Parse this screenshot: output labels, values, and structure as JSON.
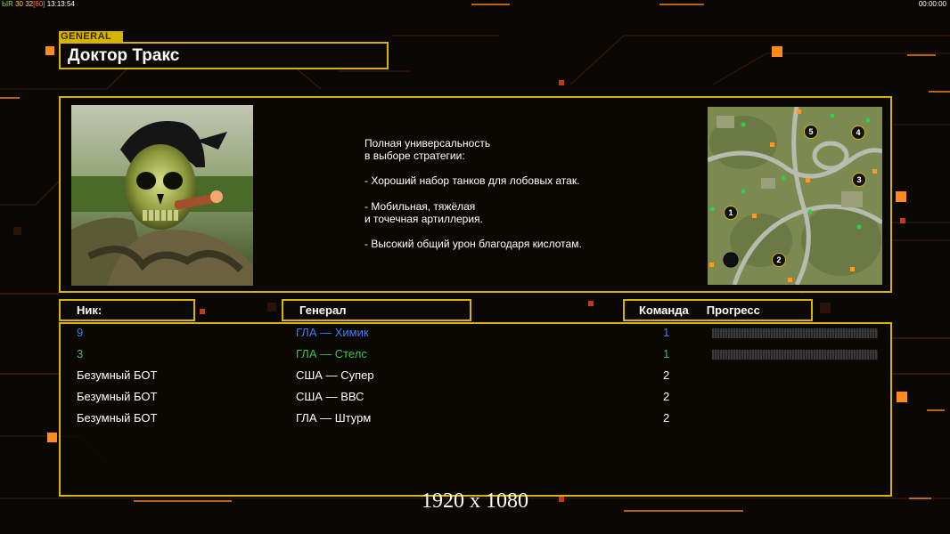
{
  "hud": {
    "left_prefix": "ЫR",
    "left_a": "30",
    "left_b": "32",
    "left_c": "[60]",
    "left_time": "13:13:54",
    "right_time": "00:00:00"
  },
  "general": {
    "tag": "GENERAL",
    "name": "Доктор Тракс",
    "description": [
      "Полная универсальность",
      "в выборе стратегии:",
      "",
      "- Хороший набор танков для лобовых атак.",
      "",
      "- Мобильная, тяжёлая",
      "и точечная артиллерия.",
      "",
      "- Высокий общий урон благодаря кислотам."
    ]
  },
  "minimap": {
    "start_positions": [
      "1",
      "2",
      "3",
      "4",
      "5"
    ]
  },
  "table": {
    "headers": {
      "nick": "Ник:",
      "general": "Генерал",
      "team": "Команда",
      "progress": "Прогресс"
    },
    "rows": [
      {
        "nick": "9",
        "general": "ГЛА — Химик",
        "team": "1",
        "color": "#3f7bff",
        "has_progress": true,
        "progress": 0
      },
      {
        "nick": "3",
        "general": "ГЛА — Стелс",
        "team": "1",
        "color": "#3ec23e",
        "has_progress": true,
        "progress": 0
      },
      {
        "nick": "Безумный БОТ",
        "general": "США — Супер",
        "team": "2",
        "color": "#ffffff",
        "has_progress": false
      },
      {
        "nick": "Безумный БОТ",
        "general": "США — ВВС",
        "team": "2",
        "color": "#ffffff",
        "has_progress": false
      },
      {
        "nick": "Безумный БОТ",
        "general": "ГЛА — Штурм",
        "team": "2",
        "color": "#ffffff",
        "has_progress": false
      }
    ]
  },
  "overlay": {
    "resolution": "1920 x 1080"
  },
  "colors": {
    "frame": "#d7b400",
    "accent_orange": "#ff8a1e",
    "background": "#0b0705"
  }
}
